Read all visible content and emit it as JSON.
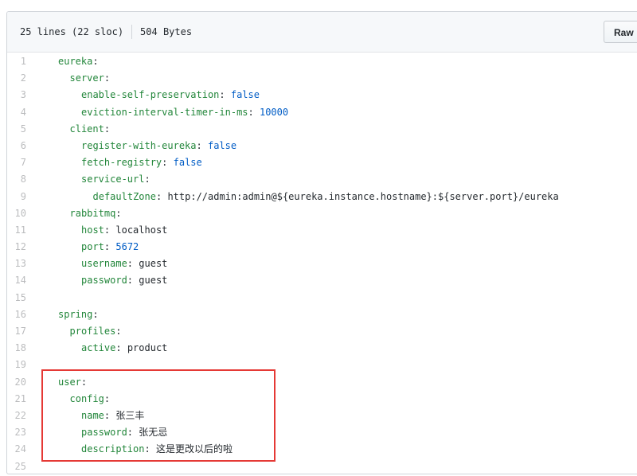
{
  "file_header": {
    "lines_info": "25 lines (22 sloc)",
    "size": "504 Bytes",
    "raw_label": "Raw"
  },
  "code_lines": [
    {
      "n": "1",
      "indent": 0,
      "key": "eureka",
      "value": "",
      "vtype": ""
    },
    {
      "n": "2",
      "indent": 1,
      "key": "server",
      "value": "",
      "vtype": ""
    },
    {
      "n": "3",
      "indent": 2,
      "key": "enable-self-preservation",
      "value": "false",
      "vtype": "bool"
    },
    {
      "n": "4",
      "indent": 2,
      "key": "eviction-interval-timer-in-ms",
      "value": "10000",
      "vtype": "num"
    },
    {
      "n": "5",
      "indent": 1,
      "key": "client",
      "value": "",
      "vtype": ""
    },
    {
      "n": "6",
      "indent": 2,
      "key": "register-with-eureka",
      "value": "false",
      "vtype": "bool"
    },
    {
      "n": "7",
      "indent": 2,
      "key": "fetch-registry",
      "value": "false",
      "vtype": "bool"
    },
    {
      "n": "8",
      "indent": 2,
      "key": "service-url",
      "value": "",
      "vtype": ""
    },
    {
      "n": "9",
      "indent": 3,
      "key": "defaultZone",
      "value": "http://admin:admin@${eureka.instance.hostname}:${server.port}/eureka",
      "vtype": "str"
    },
    {
      "n": "10",
      "indent": 1,
      "key": "rabbitmq",
      "value": "",
      "vtype": ""
    },
    {
      "n": "11",
      "indent": 2,
      "key": "host",
      "value": "localhost",
      "vtype": "str"
    },
    {
      "n": "12",
      "indent": 2,
      "key": "port",
      "value": "5672",
      "vtype": "num"
    },
    {
      "n": "13",
      "indent": 2,
      "key": "username",
      "value": "guest",
      "vtype": "str"
    },
    {
      "n": "14",
      "indent": 2,
      "key": "password",
      "value": "guest",
      "vtype": "str"
    },
    {
      "n": "15",
      "indent": 0,
      "key": "",
      "value": "",
      "vtype": ""
    },
    {
      "n": "16",
      "indent": 0,
      "key": "spring",
      "value": "",
      "vtype": ""
    },
    {
      "n": "17",
      "indent": 1,
      "key": "profiles",
      "value": "",
      "vtype": ""
    },
    {
      "n": "18",
      "indent": 2,
      "key": "active",
      "value": "product",
      "vtype": "str"
    },
    {
      "n": "19",
      "indent": 0,
      "key": "",
      "value": "",
      "vtype": ""
    },
    {
      "n": "20",
      "indent": 0,
      "key": "user",
      "value": "",
      "vtype": ""
    },
    {
      "n": "21",
      "indent": 1,
      "key": "config",
      "value": "",
      "vtype": ""
    },
    {
      "n": "22",
      "indent": 2,
      "key": "name",
      "value": "张三丰",
      "vtype": "cjk"
    },
    {
      "n": "23",
      "indent": 2,
      "key": "password",
      "value": "张无忌",
      "vtype": "cjk"
    },
    {
      "n": "24",
      "indent": 2,
      "key": "description",
      "value": "这是更改以后的啦",
      "vtype": "cjk"
    },
    {
      "n": "25",
      "indent": 0,
      "key": "",
      "value": "",
      "vtype": ""
    }
  ],
  "colors": {
    "key": "#22863a",
    "literal": "#005cc5",
    "line_number": "#b9bbbc",
    "highlight_box": "#e53935"
  }
}
